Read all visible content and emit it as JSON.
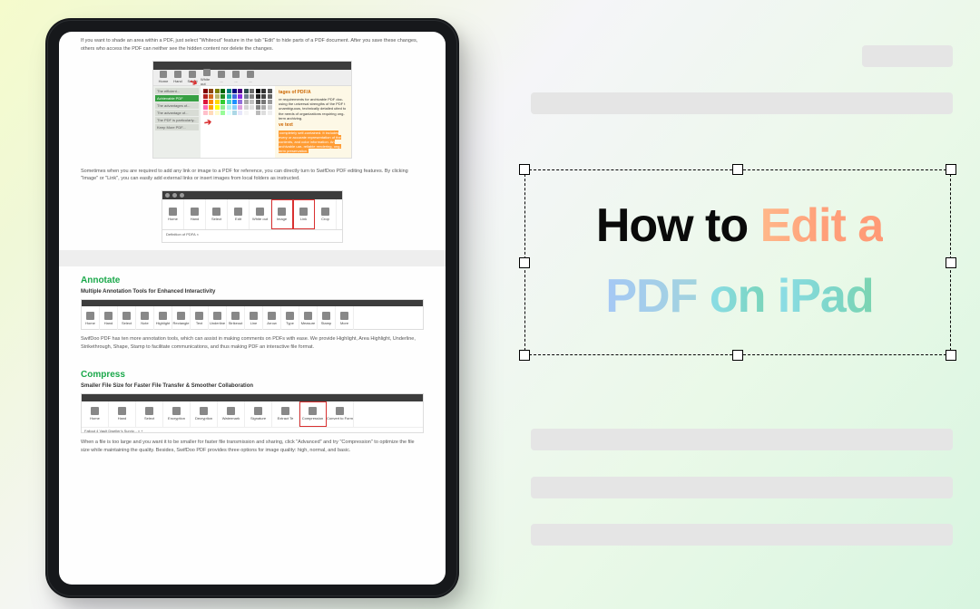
{
  "title": {
    "part1": "How to ",
    "part2_edit": "Edit a",
    "part3_pdf": "PDF ",
    "part4_on": "on ",
    "part5_ipad": "iPad"
  },
  "ipad_doc": {
    "para1": "If you want to shade an area within a PDF, just select \"Whiteout\" feature in the tab \"Edit\" to hide parts of a PDF document. After you save these changes, others who access the PDF can neither see the hidden content nor delete the changes.",
    "shot1": {
      "side_items": [
        "The efficient...",
        "Achievable PDF document",
        "The advantages of...",
        "The advantage of...",
        "The PDF is particularly...",
        "Keep More PDF..."
      ],
      "right_heading": "tages of PDF/A",
      "right_body": "re requirements for archivable PDF doc- using the universal strengths of the PDF t unambiguous, technically detailed uited to the needs of organizations requiring ong-term archiving.",
      "right_sub_heading": "ve text",
      "right_sub_body": "completely self-contained. It includes every or accurate representation of the contents, and color information. An archivable uar- reliable rendering, ong-term preservation.",
      "tabs": [
        "Home",
        "Hand",
        "Select",
        "White out",
        "...",
        "...",
        "..."
      ]
    },
    "para2": "Sometimes when you are required to add any link or image to a PDF for reference, you can directly turn to SwifDoo PDF editing features. By clicking \"Image\" or \"Link\", you can easily add external links or insert images from local folders as instructed.",
    "shot2": {
      "tabs": [
        "Home",
        "Hand",
        "Select",
        "Edit",
        "White out",
        "Image",
        "Link",
        "Crop"
      ],
      "sub": "Definition of PDFA ×"
    },
    "annotate": {
      "heading": "Annotate",
      "sub": "Multiple Annotation Tools for Enhanced Interactivity",
      "tabs": [
        "Home",
        "Hand",
        "Select",
        "Note",
        "Highlight",
        "Rectangle",
        "Text",
        "Underline",
        "Strikeout",
        "Line",
        "Arrow",
        "Type",
        "Measure",
        "Stamp",
        "More"
      ],
      "para": "SwifDoo PDF has ten more annotation tools, which can assist in making comments on PDFs with ease. We provide Highlight, Area Highlight, Underline, Strikethrough, Shape, Stamp to facilitate communications, and thus making PDF an interactive file format."
    },
    "compress": {
      "heading": "Compress",
      "sub": "Smaller File Size for Faster File Transfer & Smoother Collaboration",
      "tabs": [
        "Home",
        "Hand",
        "Select",
        "Encryption",
        "Decryption",
        "Watermark",
        "Signature",
        "Extract Te",
        "Compression",
        "Convert to Form"
      ],
      "sub_line": "Fallout 4 Vault Dweller's Surviv...  ×   +",
      "para": "When a file is too large and you want it to be smaller for faster file transmission and sharing, click \"Advanced\" and try \"Compression\" to optimize the file size while maintaining the quality. Besides, SwifDoo PDF provides three options for image quality: high, normal, and basic."
    }
  },
  "swatches": [
    "#800000",
    "#8b4513",
    "#808000",
    "#006400",
    "#008080",
    "#000080",
    "#4b0082",
    "#2f4f4f",
    "#696969",
    "#000000",
    "#333333",
    "#555555",
    "#b22222",
    "#d2691e",
    "#bdb76b",
    "#228b22",
    "#20b2aa",
    "#4169e1",
    "#8a2be2",
    "#708090",
    "#808080",
    "#222222",
    "#444444",
    "#666666",
    "#dc143c",
    "#ff8c00",
    "#ffd700",
    "#32cd32",
    "#48d1cc",
    "#1e90ff",
    "#9370db",
    "#a9a9a9",
    "#c0c0c0",
    "#555555",
    "#777777",
    "#999999",
    "#ff69b4",
    "#ffa500",
    "#ffff00",
    "#90ee90",
    "#afeeee",
    "#87cefa",
    "#dda0dd",
    "#d3d3d3",
    "#e0e0e0",
    "#888888",
    "#aaaaaa",
    "#cccccc",
    "#ffc0cb",
    "#ffdab9",
    "#fffacd",
    "#98fb98",
    "#e0ffff",
    "#add8e6",
    "#e6e6fa",
    "#f5f5f5",
    "#ffffff",
    "#bbbbbb",
    "#dddddd",
    "#eeeeee"
  ]
}
